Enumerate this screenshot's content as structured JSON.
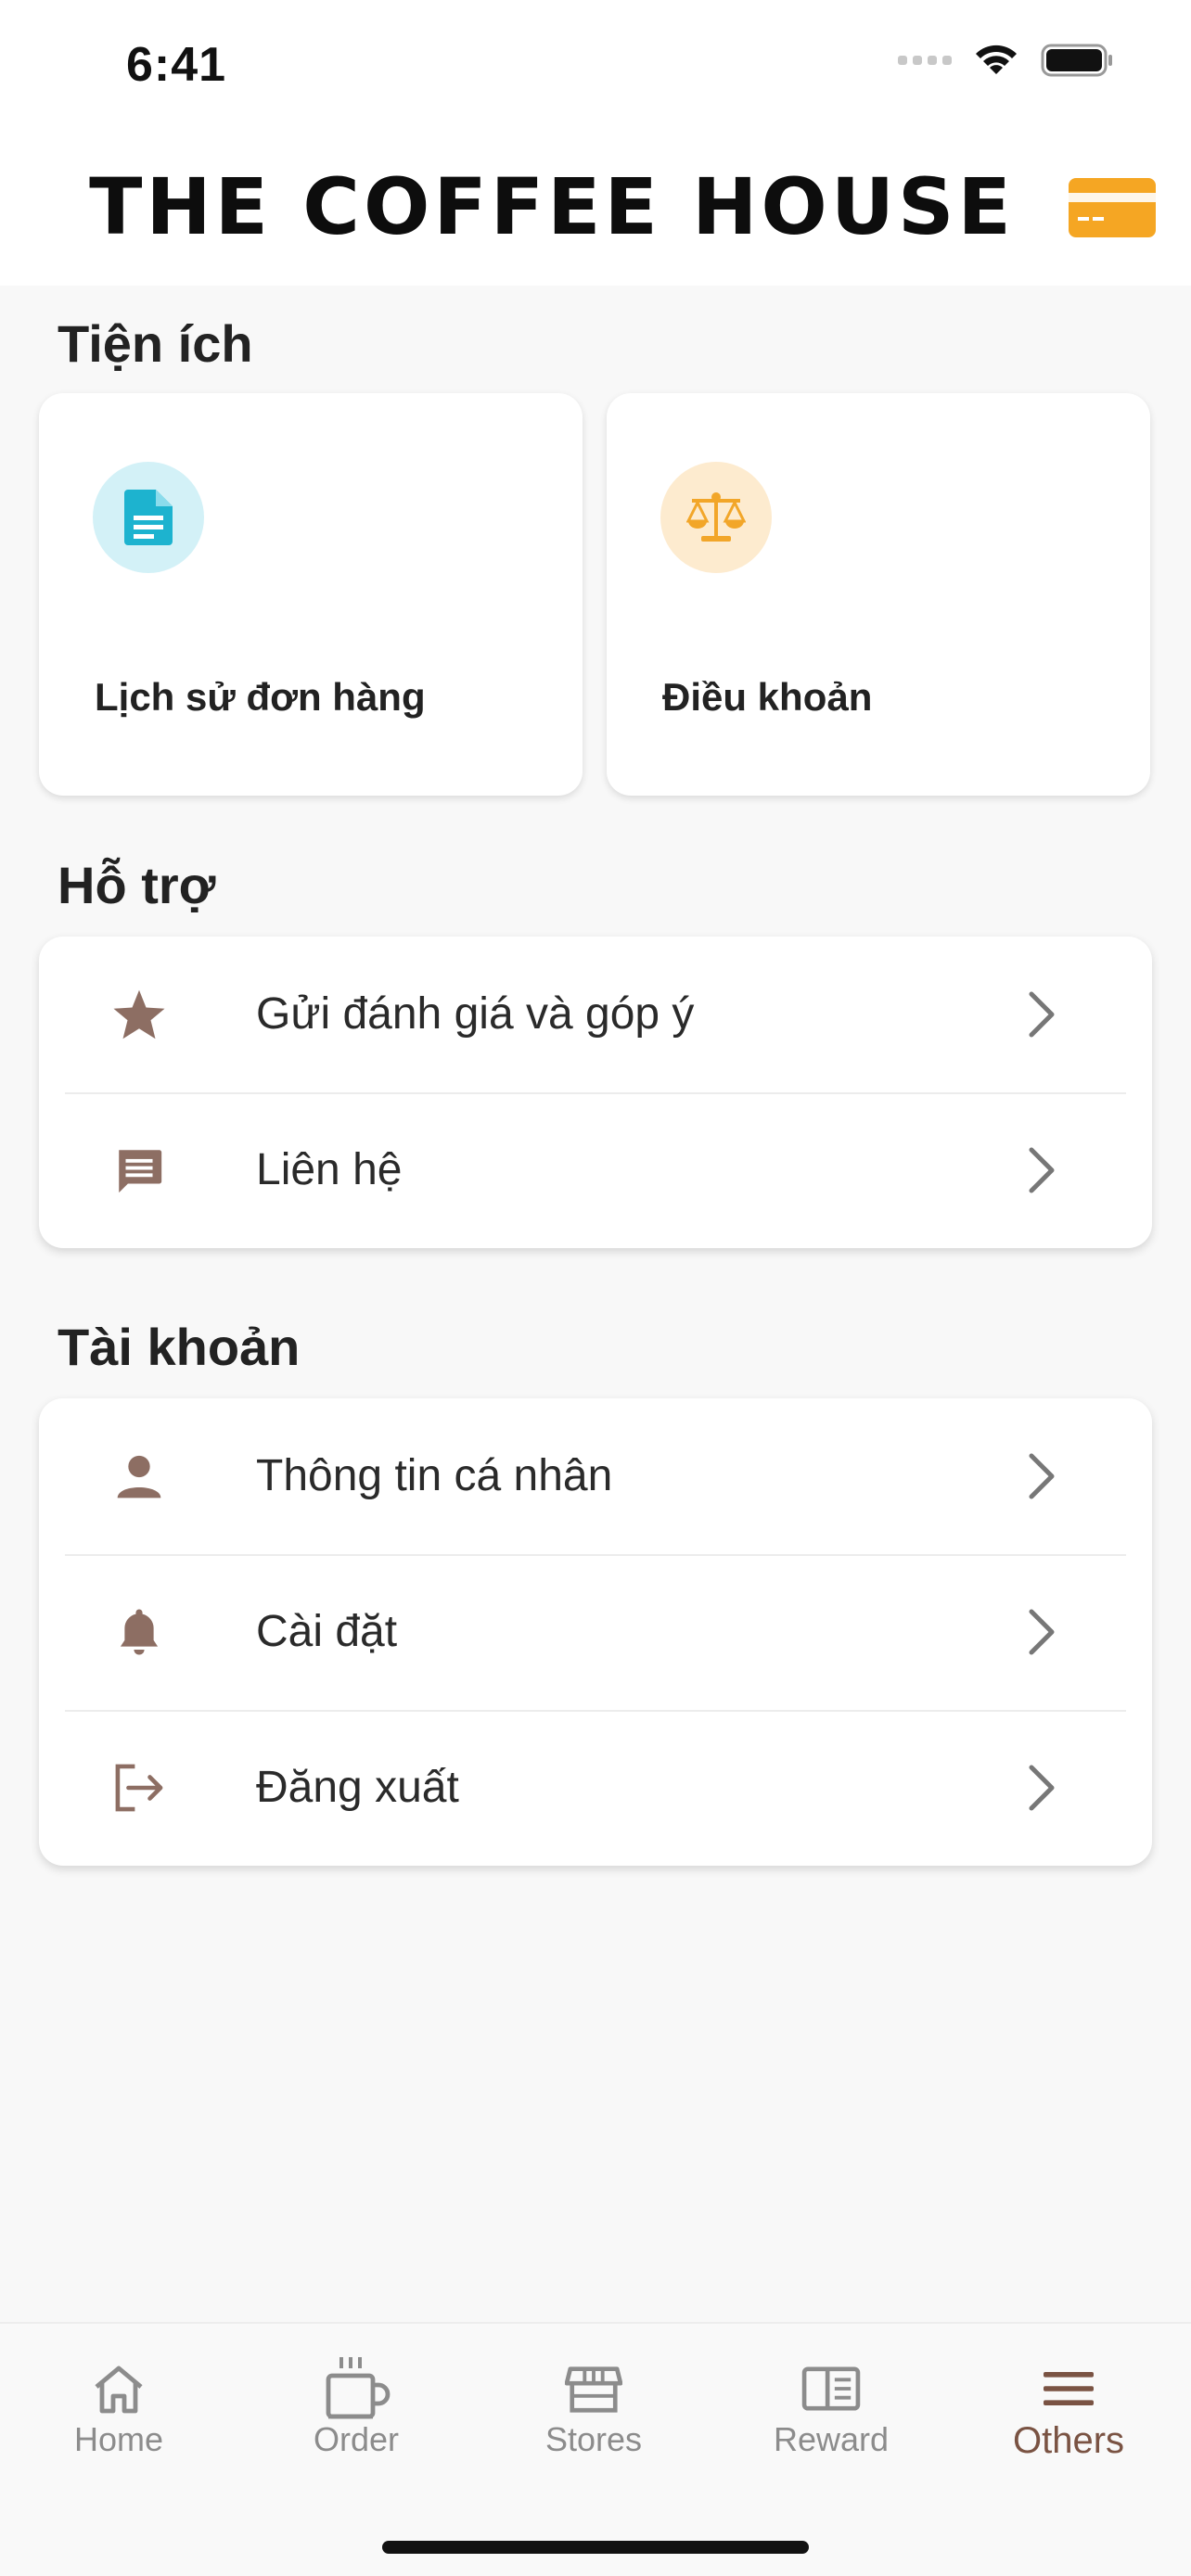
{
  "status": {
    "time": "6:41"
  },
  "header": {
    "logo": "THE COFFEE HOUSE",
    "card_icon": "membership-card-icon"
  },
  "sections": {
    "utilities": {
      "title": "Tiện ích",
      "cards": [
        {
          "label": "Lịch sử đơn hàng",
          "icon": "document-icon",
          "color": "#1db3cf",
          "bg": "#d3f1f7"
        },
        {
          "label": "Điều khoản",
          "icon": "scale-icon",
          "color": "#f2a629",
          "bg": "#fdebcf"
        }
      ]
    },
    "support": {
      "title": "Hỗ trợ",
      "items": [
        {
          "label": "Gửi đánh giá và góp ý",
          "icon": "star-icon"
        },
        {
          "label": "Liên hệ",
          "icon": "message-icon"
        }
      ]
    },
    "account": {
      "title": "Tài khoản",
      "items": [
        {
          "label": "Thông tin cá nhân",
          "icon": "person-icon"
        },
        {
          "label": "Cài đặt",
          "icon": "bell-icon"
        },
        {
          "label": "Đăng xuất",
          "icon": "logout-icon"
        }
      ]
    }
  },
  "tabs": [
    {
      "label": "Home",
      "icon": "home-icon"
    },
    {
      "label": "Order",
      "icon": "coffee-cup-icon"
    },
    {
      "label": "Stores",
      "icon": "store-icon"
    },
    {
      "label": "Reward",
      "icon": "reward-book-icon"
    },
    {
      "label": "Others",
      "icon": "menu-icon",
      "active": true
    }
  ],
  "colors": {
    "icon_brown": "#8d6e63",
    "active_tab": "#7a5343",
    "chevron": "#777777",
    "accent_orange": "#f5a623"
  }
}
